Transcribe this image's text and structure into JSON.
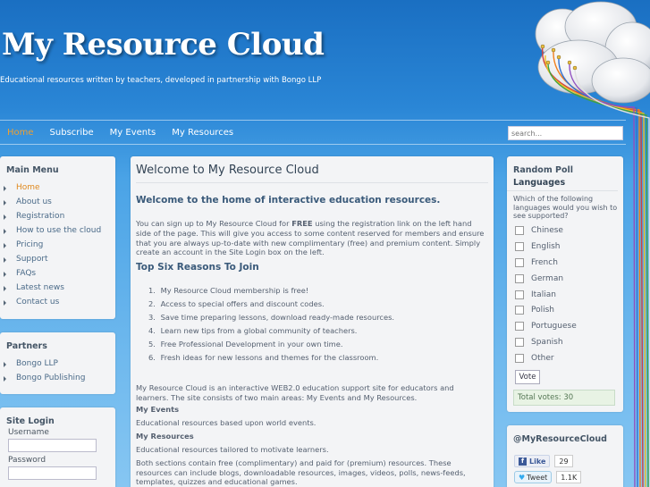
{
  "header": {
    "title": "My Resource Cloud",
    "tagline": "Educational resources written by teachers, developed in partnership with Bongo LLP"
  },
  "nav": {
    "items": [
      "Home",
      "Subscribe",
      "My Events",
      "My Resources"
    ],
    "active": "Home",
    "search_placeholder": "search..."
  },
  "main_menu": {
    "title": "Main Menu",
    "items": [
      "Home",
      "About us",
      "Registration",
      "How to use the cloud",
      "Pricing",
      "Support",
      "FAQs",
      "Latest news",
      "Contact us"
    ]
  },
  "partners": {
    "title": "Partners",
    "items": [
      "Bongo LLP",
      "Bongo Publishing"
    ]
  },
  "login": {
    "title": "Site Login",
    "username_label": "Username",
    "password_label": "Password"
  },
  "main": {
    "title": "Welcome to My Resource Cloud",
    "welcome_heading": "Welcome to the home of interactive education resources.",
    "intro_before": "You can sign up to My Resource Cloud for ",
    "intro_bold": "FREE",
    "intro_after": " using the registration link on the left hand side of the page. This will give you access to some content reserved for members and ensure that you are always up-to-date with new complimentary (free) and premium content.  Simply create an account in the Site Login box on the left.",
    "reasons_heading": "Top Six Reasons To Join",
    "reasons": [
      "My Resource Cloud membership is free!",
      "Access to special offers and discount codes.",
      "Save time preparing lessons, download ready-made resources.",
      "Learn new tips from a global community of teachers.",
      "Free Professional Development in your own time.",
      "Fresh ideas for new lessons and themes for the classroom."
    ],
    "about": "My Resource Cloud is an interactive WEB2.0 education support site for educators and learners. The site consists of two main areas: My Events and My Resources.",
    "events_heading": "My Events",
    "events_text": "Educational resources based upon world events.",
    "resources_heading": "My Resources",
    "resources_text": "Educational resources tailored to motivate learners.",
    "both_text": "Both sections contain free (complimentary) and paid for (premium) resources. These resources can include blogs, downloadable resources, images, videos, polls, news-feeds, templates, quizzes and educational games."
  },
  "poll": {
    "title": "Random Poll",
    "subtitle": "Languages",
    "question": "Which of the following languages would you wish to see supported?",
    "options": [
      "Chinese",
      "English",
      "French",
      "German",
      "Italian",
      "Polish",
      "Portuguese",
      "Spanish",
      "Other"
    ],
    "vote_label": "Vote",
    "total_votes": "Total votes: 30"
  },
  "social": {
    "title": "@MyResourceCloud",
    "like_label": "Like",
    "like_count": "29",
    "tweet_label": "Tweet",
    "tweet_count": "1.1K"
  },
  "colors": {
    "accent": "#f0a030",
    "background": "#2a86d6",
    "panel": "#f3f4f6"
  }
}
